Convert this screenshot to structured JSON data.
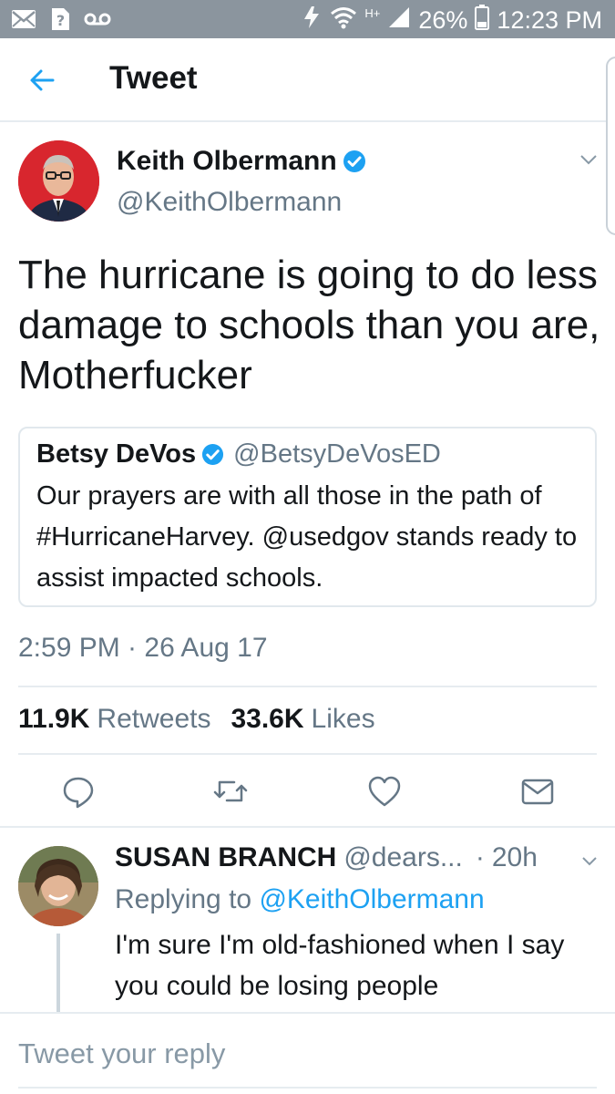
{
  "status_bar": {
    "battery": "26%",
    "time": "12:23 PM",
    "network": "H+",
    "icons": [
      "mail-icon",
      "unknown-app-icon",
      "voicemail-icon",
      "data-saver-icon",
      "wifi-icon",
      "signal-icon",
      "battery-icon"
    ]
  },
  "header": {
    "title": "Tweet",
    "back_icon": "back-arrow-icon"
  },
  "tweet": {
    "author_name": "Keith Olbermann",
    "author_handle": "@KeithOlbermann",
    "text": "The hurricane is going to do less damage to schools than you are, Motherfucker",
    "quoted": {
      "name": "Betsy DeVos",
      "handle": "@BetsyDeVosED",
      "text": "Our prayers are with all those in the path of #HurricaneHarvey. @usedgov stands ready to assist impacted schools."
    },
    "timestamp": "2:59 PM · 26 Aug 17",
    "retweets_count": "11.9K",
    "retweets_label": "Retweets",
    "likes_count": "33.6K",
    "likes_label": "Likes",
    "actions": [
      "reply-icon",
      "retweet-icon",
      "like-icon",
      "direct-message-icon"
    ]
  },
  "reply": {
    "name": "SUSAN BRANCH",
    "handle": "@dears...",
    "separator": "·",
    "time": "20h",
    "replying_prefix": "Replying to",
    "replying_to": "@KeithOlbermann",
    "text": "I'm sure I'm old-fashioned when I say you could be losing people"
  },
  "compose": {
    "placeholder": "Tweet your reply"
  },
  "colors": {
    "accent": "#1da1f2",
    "text_primary": "#14171a",
    "text_secondary": "#657786",
    "divider": "#e6ecf0",
    "status_bar": "#8b959e"
  }
}
